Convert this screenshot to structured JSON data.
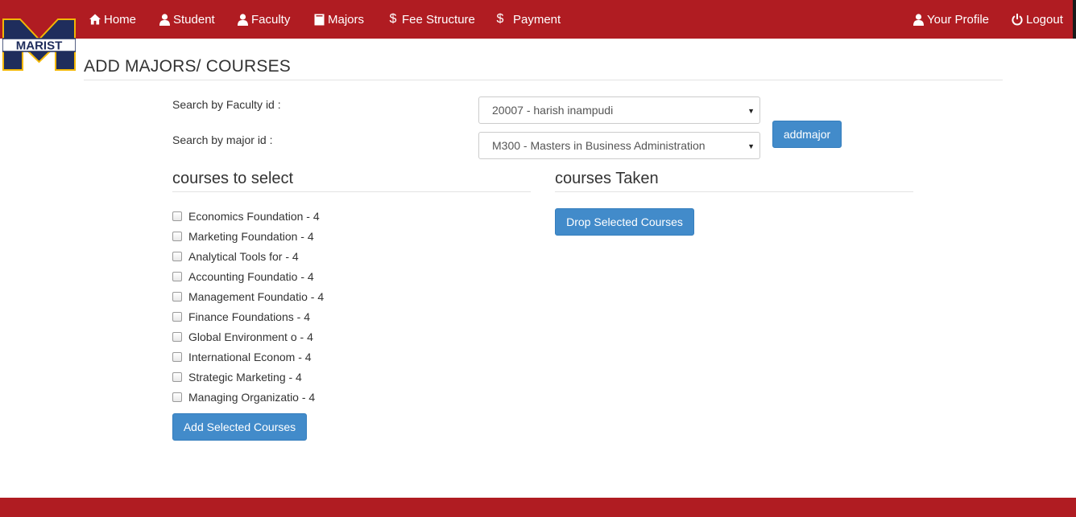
{
  "nav": {
    "home": "Home",
    "student": "Student",
    "faculty": "Faculty",
    "majors": "Majors",
    "fee_structure": "Fee Structure",
    "payment": "Payment",
    "profile": "Your Profile",
    "logout": "Logout",
    "dollar_symbol": "$"
  },
  "logo": {
    "text": "MARIST"
  },
  "page": {
    "title": "ADD MAJORS/ COURSES"
  },
  "search": {
    "faculty_label": "Search by Faculty id :",
    "faculty_value": "20007 - harish inampudi",
    "major_label": "Search by major id :",
    "major_value": "M300 - Masters in Business Administration",
    "caret": "▼",
    "addmajor_label": "addmajor"
  },
  "courses_to_select": {
    "title": "courses to select",
    "items": [
      "Economics Foundation - 4",
      "Marketing Foundation - 4",
      "Analytical Tools for - 4",
      "Accounting Foundatio - 4",
      "Management Foundatio - 4",
      "Finance Foundations - 4",
      "Global Environment o - 4",
      "International Econom - 4",
      "Strategic Marketing - 4",
      "Managing Organizatio - 4"
    ],
    "add_button": "Add Selected Courses"
  },
  "courses_taken": {
    "title": "courses Taken",
    "drop_button": "Drop Selected Courses"
  },
  "colors": {
    "brand_red": "#b01c22",
    "button_blue": "#428bca",
    "logo_navy": "#1f2d5c",
    "logo_gold": "#f2b705"
  }
}
